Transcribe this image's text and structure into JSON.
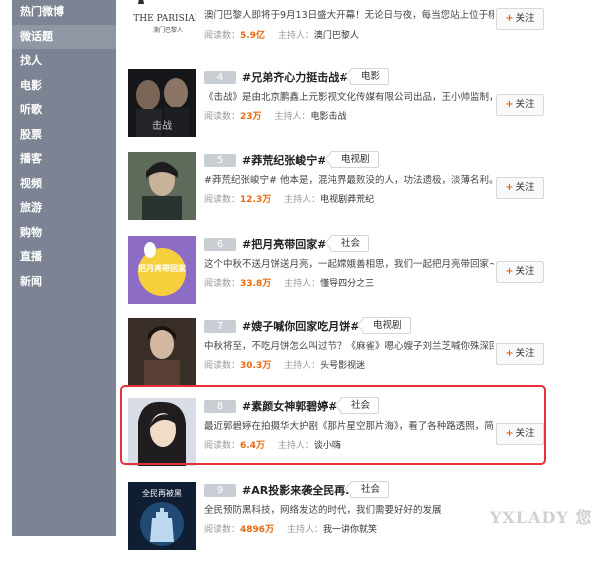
{
  "sidebar": {
    "items": [
      {
        "label": "热门微博",
        "active": false
      },
      {
        "label": "微话题",
        "active": true
      },
      {
        "label": "找人",
        "active": false
      },
      {
        "label": "电影",
        "active": false
      },
      {
        "label": "听歌",
        "active": false
      },
      {
        "label": "股票",
        "active": false
      },
      {
        "label": "播客",
        "active": false
      },
      {
        "label": "视频",
        "active": false
      },
      {
        "label": "旅游",
        "active": false
      },
      {
        "label": "购物",
        "active": false
      },
      {
        "label": "直播",
        "active": false
      },
      {
        "label": "新闻",
        "active": false
      }
    ]
  },
  "labels": {
    "reads": "阅读数：",
    "host": "主持人：",
    "follow": "关注",
    "follow_plus": "+"
  },
  "rows": [
    {
      "rank": "",
      "title": "",
      "tag": "",
      "desc": "澳门巴黎人即将于9月13日盛大开幕！无论日与夜，每当您站上位于栩栩复...",
      "reads": "5.9亿",
      "host": "澳门巴黎人",
      "thumb_text": "THE PARISIAN",
      "thumb_sub": "澳门巴黎人"
    },
    {
      "rank": "4",
      "title": "#兄弟齐心力挺击战#",
      "tag": "电影",
      "desc": "《击战》是由北京鹏鑫上元影视文化传媒有限公司出品，王小帅监制，闫...",
      "reads": "23万",
      "host": "电影击战",
      "thumb_text": "击战"
    },
    {
      "rank": "5",
      "title": "#莽荒纪张峻宁#",
      "tag": "电视剧",
      "desc": "#莽荒纪张峻宁# 他本是，混沌界最败没的人，功法遗极，淡薄名利。世间...",
      "reads": "12.3万",
      "host": "电视剧莽荒纪",
      "thumb_text": ""
    },
    {
      "rank": "6",
      "title": "#把月亮带回家#",
      "tag": "社会",
      "desc": "这个中秋不送月饼送月亮，一起嫦娥善相思，我们一起把月亮带回家~",
      "reads": "33.8万",
      "host": "懂导四分之三",
      "thumb_text": "把月亮带回家"
    },
    {
      "rank": "7",
      "title": "#嫂子喊你回家吃月饼#",
      "tag": "电视剧",
      "desc": "中秋将至，不吃月饼怎么叫过节？《麻雀》嗯心嫂子刘兰芝喊你殊深回家...",
      "reads": "30.3万",
      "host": "头号影视迷",
      "thumb_text": ""
    },
    {
      "rank": "8",
      "title": "#素颜女神郭碧婷#",
      "tag": "社会",
      "desc": "最近郭碧婷在拍摄华大护剧《那片星空那片海》，看了各种路透照，简直...",
      "reads": "6.4万",
      "host": "谈小嗨",
      "thumb_text": ""
    },
    {
      "rank": "9",
      "title": "#AR投影来袭全民再...",
      "tag": "社会",
      "desc": "全民预防黑科技，网络发达的时代，我们需要好好的发展",
      "reads": "4896万",
      "host": "我一讲你就笑",
      "thumb_text": "全民再被黑"
    }
  ],
  "watermark": "YXLADY 您",
  "colors": {
    "sidebar_bg": "#7c8392",
    "accent_orange": "#e8690f",
    "highlight_red": "#e8313a",
    "rank_badge": "#c9cdd4"
  }
}
